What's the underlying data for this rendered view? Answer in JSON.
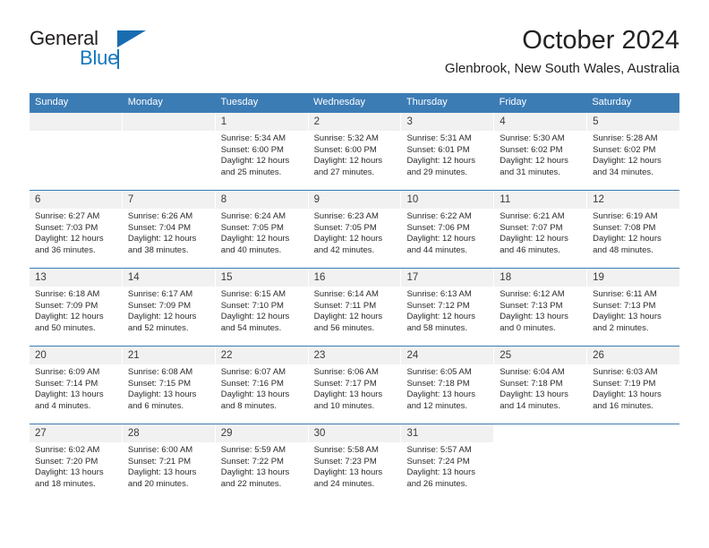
{
  "brand": {
    "name_part1": "General",
    "name_part2": "Blue",
    "triangle_icon": "triangle-icon",
    "colors": {
      "dark": "#231f20",
      "blue": "#1477be",
      "triangle": "#1a6cb0"
    }
  },
  "header": {
    "title": "October 2024",
    "subtitle": "Glenbrook, New South Wales, Australia"
  },
  "calendar": {
    "accent_color": "#3c7cb5",
    "daynumber_bg": "#f1f1f1",
    "weekdays": [
      "Sunday",
      "Monday",
      "Tuesday",
      "Wednesday",
      "Thursday",
      "Friday",
      "Saturday"
    ],
    "weeks": [
      [
        {
          "day": "",
          "empty": true
        },
        {
          "day": "",
          "empty": true
        },
        {
          "day": "1",
          "sunrise": "Sunrise: 5:34 AM",
          "sunset": "Sunset: 6:00 PM",
          "daylight1": "Daylight: 12 hours",
          "daylight2": "and 25 minutes."
        },
        {
          "day": "2",
          "sunrise": "Sunrise: 5:32 AM",
          "sunset": "Sunset: 6:00 PM",
          "daylight1": "Daylight: 12 hours",
          "daylight2": "and 27 minutes."
        },
        {
          "day": "3",
          "sunrise": "Sunrise: 5:31 AM",
          "sunset": "Sunset: 6:01 PM",
          "daylight1": "Daylight: 12 hours",
          "daylight2": "and 29 minutes."
        },
        {
          "day": "4",
          "sunrise": "Sunrise: 5:30 AM",
          "sunset": "Sunset: 6:02 PM",
          "daylight1": "Daylight: 12 hours",
          "daylight2": "and 31 minutes."
        },
        {
          "day": "5",
          "sunrise": "Sunrise: 5:28 AM",
          "sunset": "Sunset: 6:02 PM",
          "daylight1": "Daylight: 12 hours",
          "daylight2": "and 34 minutes."
        }
      ],
      [
        {
          "day": "6",
          "sunrise": "Sunrise: 6:27 AM",
          "sunset": "Sunset: 7:03 PM",
          "daylight1": "Daylight: 12 hours",
          "daylight2": "and 36 minutes."
        },
        {
          "day": "7",
          "sunrise": "Sunrise: 6:26 AM",
          "sunset": "Sunset: 7:04 PM",
          "daylight1": "Daylight: 12 hours",
          "daylight2": "and 38 minutes."
        },
        {
          "day": "8",
          "sunrise": "Sunrise: 6:24 AM",
          "sunset": "Sunset: 7:05 PM",
          "daylight1": "Daylight: 12 hours",
          "daylight2": "and 40 minutes."
        },
        {
          "day": "9",
          "sunrise": "Sunrise: 6:23 AM",
          "sunset": "Sunset: 7:05 PM",
          "daylight1": "Daylight: 12 hours",
          "daylight2": "and 42 minutes."
        },
        {
          "day": "10",
          "sunrise": "Sunrise: 6:22 AM",
          "sunset": "Sunset: 7:06 PM",
          "daylight1": "Daylight: 12 hours",
          "daylight2": "and 44 minutes."
        },
        {
          "day": "11",
          "sunrise": "Sunrise: 6:21 AM",
          "sunset": "Sunset: 7:07 PM",
          "daylight1": "Daylight: 12 hours",
          "daylight2": "and 46 minutes."
        },
        {
          "day": "12",
          "sunrise": "Sunrise: 6:19 AM",
          "sunset": "Sunset: 7:08 PM",
          "daylight1": "Daylight: 12 hours",
          "daylight2": "and 48 minutes."
        }
      ],
      [
        {
          "day": "13",
          "sunrise": "Sunrise: 6:18 AM",
          "sunset": "Sunset: 7:09 PM",
          "daylight1": "Daylight: 12 hours",
          "daylight2": "and 50 minutes."
        },
        {
          "day": "14",
          "sunrise": "Sunrise: 6:17 AM",
          "sunset": "Sunset: 7:09 PM",
          "daylight1": "Daylight: 12 hours",
          "daylight2": "and 52 minutes."
        },
        {
          "day": "15",
          "sunrise": "Sunrise: 6:15 AM",
          "sunset": "Sunset: 7:10 PM",
          "daylight1": "Daylight: 12 hours",
          "daylight2": "and 54 minutes."
        },
        {
          "day": "16",
          "sunrise": "Sunrise: 6:14 AM",
          "sunset": "Sunset: 7:11 PM",
          "daylight1": "Daylight: 12 hours",
          "daylight2": "and 56 minutes."
        },
        {
          "day": "17",
          "sunrise": "Sunrise: 6:13 AM",
          "sunset": "Sunset: 7:12 PM",
          "daylight1": "Daylight: 12 hours",
          "daylight2": "and 58 minutes."
        },
        {
          "day": "18",
          "sunrise": "Sunrise: 6:12 AM",
          "sunset": "Sunset: 7:13 PM",
          "daylight1": "Daylight: 13 hours",
          "daylight2": "and 0 minutes."
        },
        {
          "day": "19",
          "sunrise": "Sunrise: 6:11 AM",
          "sunset": "Sunset: 7:13 PM",
          "daylight1": "Daylight: 13 hours",
          "daylight2": "and 2 minutes."
        }
      ],
      [
        {
          "day": "20",
          "sunrise": "Sunrise: 6:09 AM",
          "sunset": "Sunset: 7:14 PM",
          "daylight1": "Daylight: 13 hours",
          "daylight2": "and 4 minutes."
        },
        {
          "day": "21",
          "sunrise": "Sunrise: 6:08 AM",
          "sunset": "Sunset: 7:15 PM",
          "daylight1": "Daylight: 13 hours",
          "daylight2": "and 6 minutes."
        },
        {
          "day": "22",
          "sunrise": "Sunrise: 6:07 AM",
          "sunset": "Sunset: 7:16 PM",
          "daylight1": "Daylight: 13 hours",
          "daylight2": "and 8 minutes."
        },
        {
          "day": "23",
          "sunrise": "Sunrise: 6:06 AM",
          "sunset": "Sunset: 7:17 PM",
          "daylight1": "Daylight: 13 hours",
          "daylight2": "and 10 minutes."
        },
        {
          "day": "24",
          "sunrise": "Sunrise: 6:05 AM",
          "sunset": "Sunset: 7:18 PM",
          "daylight1": "Daylight: 13 hours",
          "daylight2": "and 12 minutes."
        },
        {
          "day": "25",
          "sunrise": "Sunrise: 6:04 AM",
          "sunset": "Sunset: 7:18 PM",
          "daylight1": "Daylight: 13 hours",
          "daylight2": "and 14 minutes."
        },
        {
          "day": "26",
          "sunrise": "Sunrise: 6:03 AM",
          "sunset": "Sunset: 7:19 PM",
          "daylight1": "Daylight: 13 hours",
          "daylight2": "and 16 minutes."
        }
      ],
      [
        {
          "day": "27",
          "sunrise": "Sunrise: 6:02 AM",
          "sunset": "Sunset: 7:20 PM",
          "daylight1": "Daylight: 13 hours",
          "daylight2": "and 18 minutes."
        },
        {
          "day": "28",
          "sunrise": "Sunrise: 6:00 AM",
          "sunset": "Sunset: 7:21 PM",
          "daylight1": "Daylight: 13 hours",
          "daylight2": "and 20 minutes."
        },
        {
          "day": "29",
          "sunrise": "Sunrise: 5:59 AM",
          "sunset": "Sunset: 7:22 PM",
          "daylight1": "Daylight: 13 hours",
          "daylight2": "and 22 minutes."
        },
        {
          "day": "30",
          "sunrise": "Sunrise: 5:58 AM",
          "sunset": "Sunset: 7:23 PM",
          "daylight1": "Daylight: 13 hours",
          "daylight2": "and 24 minutes."
        },
        {
          "day": "31",
          "sunrise": "Sunrise: 5:57 AM",
          "sunset": "Sunset: 7:24 PM",
          "daylight1": "Daylight: 13 hours",
          "daylight2": "and 26 minutes."
        },
        {
          "day": "",
          "blank": true
        },
        {
          "day": "",
          "blank": true
        }
      ]
    ]
  }
}
